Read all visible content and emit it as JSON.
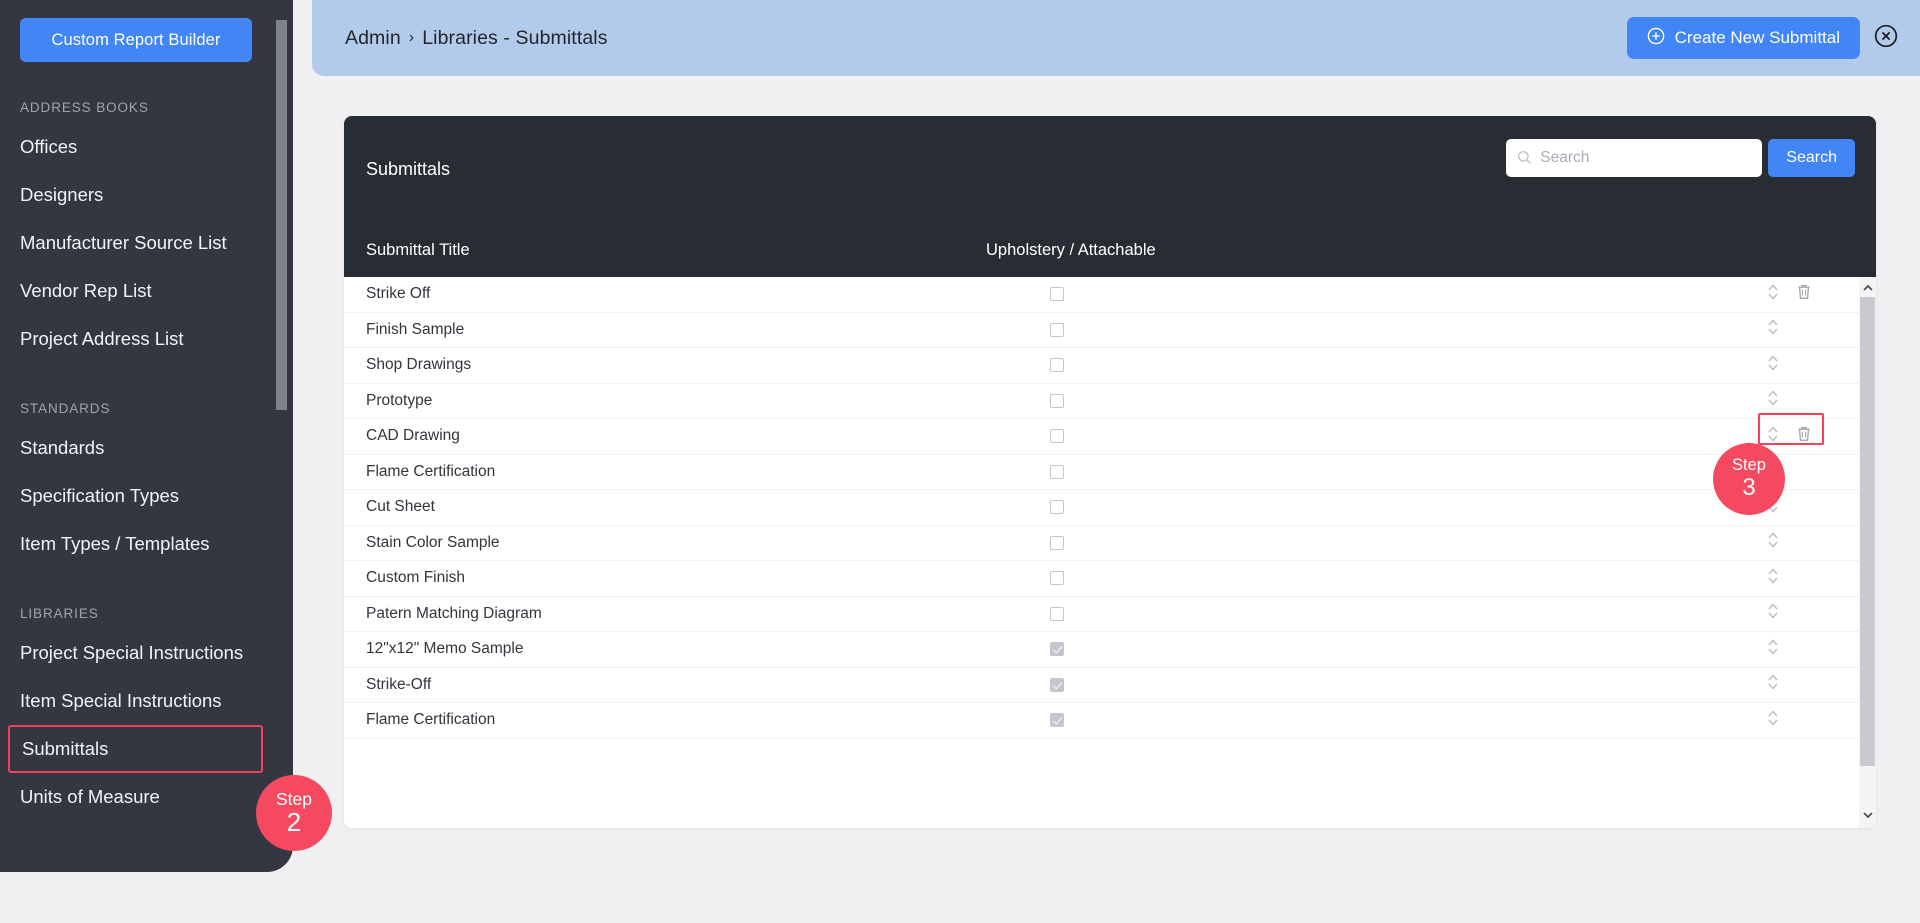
{
  "sidebar": {
    "custom_report_builder_label": "Custom Report Builder",
    "sections": [
      {
        "heading": "ADDRESS BOOKS",
        "items": [
          {
            "label": "Offices"
          },
          {
            "label": "Designers"
          },
          {
            "label": "Manufacturer Source List"
          },
          {
            "label": "Vendor Rep List"
          },
          {
            "label": "Project Address List"
          }
        ]
      },
      {
        "heading": "STANDARDS",
        "items": [
          {
            "label": "Standards"
          },
          {
            "label": "Specification Types"
          },
          {
            "label": "Item Types / Templates"
          }
        ]
      },
      {
        "heading": "LIBRARIES",
        "items": [
          {
            "label": "Project Special Instructions"
          },
          {
            "label": "Item Special Instructions"
          },
          {
            "label": "Submittals"
          },
          {
            "label": "Units of Measure"
          }
        ]
      }
    ]
  },
  "header": {
    "breadcrumb_root": "Admin",
    "breadcrumb_separator": "›",
    "breadcrumb_current": "Libraries - Submittals",
    "create_button_label": "Create New Submittal",
    "create_button_icon": "plus-circle-icon",
    "close_icon": "close-circle-icon",
    "accent_color": "#4285f4",
    "bar_color": "#b3cbeb"
  },
  "panel": {
    "title": "Submittals",
    "search": {
      "placeholder": "Search",
      "value": "",
      "button_label": "Search",
      "icon": "search-icon"
    },
    "columns": {
      "title": "Submittal Title",
      "upholstery": "Upholstery / Attachable"
    },
    "rows": [
      {
        "title": "Strike Off",
        "checked": false,
        "has_delete": true
      },
      {
        "title": "Finish Sample",
        "checked": false,
        "has_delete": false
      },
      {
        "title": "Shop Drawings",
        "checked": false,
        "has_delete": false
      },
      {
        "title": "Prototype",
        "checked": false,
        "has_delete": false
      },
      {
        "title": "CAD Drawing",
        "checked": false,
        "has_delete": true
      },
      {
        "title": "Flame Certification",
        "checked": false,
        "has_delete": false
      },
      {
        "title": "Cut Sheet",
        "checked": false,
        "has_delete": false
      },
      {
        "title": "Stain Color Sample",
        "checked": false,
        "has_delete": false
      },
      {
        "title": "Custom Finish",
        "checked": false,
        "has_delete": false
      },
      {
        "title": "Patern Matching Diagram",
        "checked": false,
        "has_delete": false
      },
      {
        "title": "12\"x12\" Memo Sample",
        "checked": true,
        "has_delete": false
      },
      {
        "title": "Strike-Off",
        "checked": true,
        "has_delete": false
      },
      {
        "title": "Flame Certification",
        "checked": true,
        "has_delete": false
      }
    ],
    "row_sort_icon": "sort-updown-icon",
    "row_delete_icon": "trash-icon"
  },
  "annotations": {
    "highlight_color": "#f2415a",
    "badge_color": "#f4495e",
    "steps": [
      {
        "id": "step2",
        "word": "Step",
        "number": "2",
        "target": "sidebar-item-submittals"
      },
      {
        "id": "step3",
        "word": "Step",
        "number": "3",
        "target": "row-actions-cad-drawing"
      }
    ]
  }
}
